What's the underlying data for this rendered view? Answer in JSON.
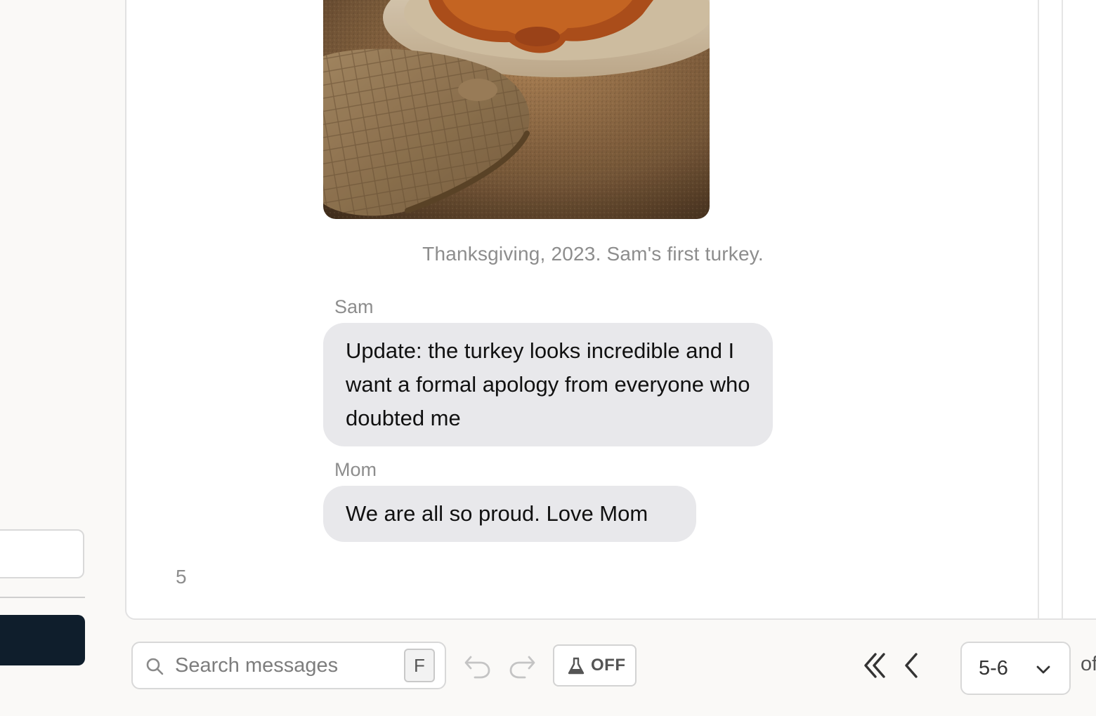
{
  "chat": {
    "photo_caption": "Thanksgiving, 2023. Sam's first turkey.",
    "messages": [
      {
        "sender": "Sam",
        "text": "Update: the turkey looks incredible and I want a formal apology from everyone who doubted me"
      },
      {
        "sender": "Mom",
        "text": "We are all so proud. Love Mom"
      }
    ],
    "page_number": "5"
  },
  "toolbar": {
    "search": {
      "placeholder": "Search messages",
      "shortcut_key": "F"
    },
    "toggle": {
      "label": "OFF",
      "icon": "flask-icon"
    },
    "undo_icon": "undo-icon",
    "redo_icon": "redo-icon",
    "pagination": {
      "first_icon": "double-chevron-left-icon",
      "prev_icon": "chevron-left-icon",
      "range": "5-6",
      "trailing_text": "of"
    }
  },
  "colors": {
    "bubble_background": "#e8e8eb",
    "muted_text": "#8d8d8d",
    "sidebar_dark_button": "#0f1e2c",
    "page_background": "#faf9f7"
  }
}
